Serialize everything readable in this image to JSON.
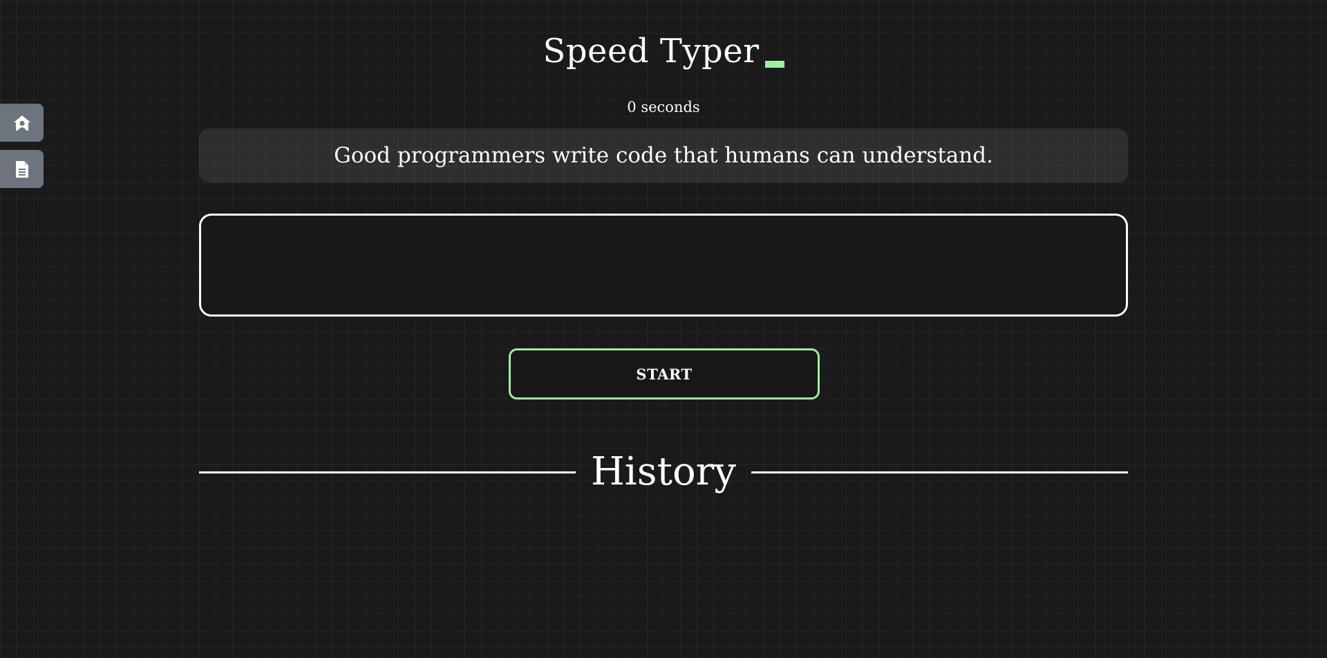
{
  "app": {
    "title": "Speed Typer",
    "accent_color": "#9ff0a0"
  },
  "side_nav": [
    {
      "icon": "home-user-icon"
    },
    {
      "icon": "document-icon"
    }
  ],
  "timer": {
    "label": "0 seconds"
  },
  "quote": {
    "text": "Good programmers write code that humans can understand."
  },
  "typing_input": {
    "value": "",
    "placeholder": ""
  },
  "controls": {
    "start_label": "START"
  },
  "history": {
    "title": "History"
  }
}
